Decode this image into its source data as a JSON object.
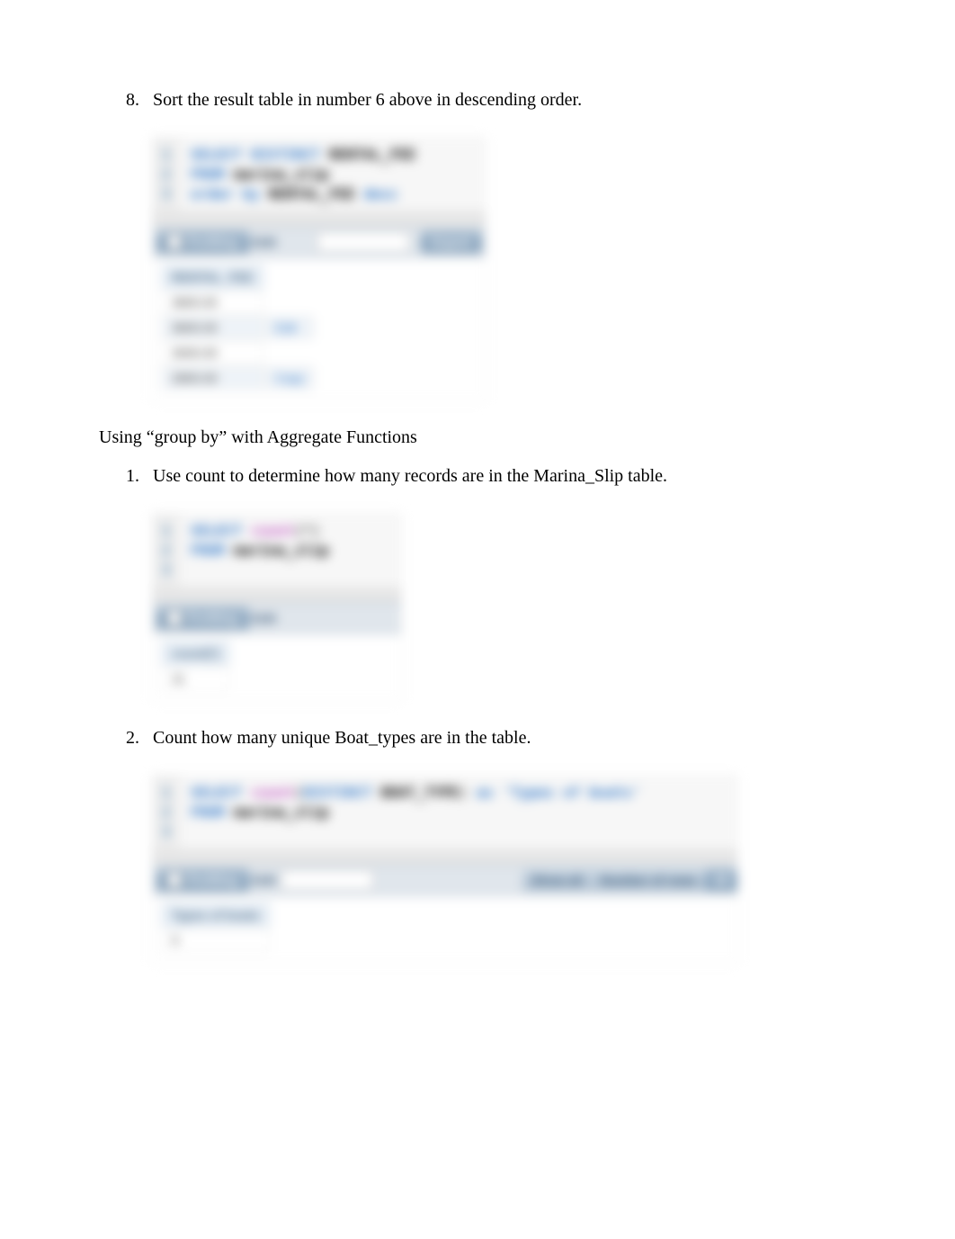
{
  "q8": {
    "num": "8.",
    "text": "Sort the result table in number 6 above in descending order."
  },
  "shot1": {
    "gutter": [
      "1",
      "2",
      "3"
    ],
    "code_html": "<span class='kw'>SELECT</span> <span class='kw'>DISTINCT</span> <span class='id'>RENTAL_FEE</span>\n<span class='kw'>FROM</span> <span class='id'>marina_slip</span>\n<span class='kw'>order by</span> <span class='id'>RENTAL_FEE</span> <span class='kw'>desc</span>",
    "toolbar": {
      "profiling": "Profiling",
      "edit": "Edit",
      "inline": "Inline",
      "extra": "Export"
    },
    "result": {
      "header": [
        "RENTAL_FEE"
      ],
      "rows": [
        [
          "3800.00"
        ],
        [
          "3600.00"
        ],
        [
          "3000.00"
        ],
        [
          "2800.00"
        ]
      ],
      "links": [
        "Edit",
        "Copy"
      ]
    }
  },
  "heading": "Using “group by” with Aggregate Functions",
  "q1": {
    "num": "1.",
    "text": "Use count to determine how many records are in the Marina_Slip table."
  },
  "shot2": {
    "gutter": [
      "1",
      "2",
      "3"
    ],
    "code_html": "<span class='kw'>SELECT</span> <span class='fn'>count</span>(*)\n<span class='kw'>FROM</span> <span class='id'>marina_slip</span>",
    "toolbar": {
      "profiling": "Profiling",
      "edit": "Edit",
      "inline": "Inline"
    },
    "result": {
      "header": [
        "count(*)"
      ],
      "rows": [
        [
          "11"
        ]
      ]
    }
  },
  "q2": {
    "num": "2.",
    "text": "Count how many unique Boat_types are in the table."
  },
  "shot3": {
    "gutter": [
      "1",
      "2",
      "3"
    ],
    "code_html": "<span class='kw'>SELECT</span> <span class='fn'>count</span>(<span class='kw'>DISTINCT</span> <span class='id'>BOAT_TYPE</span>) <span class='kw'>as</span> <span class='str'>'Types of boats'</span>\n<span class='kw'>FROM</span> <span class='id'>marina_slip</span>",
    "toolbar": {
      "profiling": "Profiling",
      "edit": "Edit",
      "inline": "Inline",
      "right1": "Show all",
      "right2": "Number of rows",
      "right3": "25"
    },
    "result": {
      "header": [
        "Types of boats"
      ],
      "rows": [
        [
          "5"
        ]
      ]
    }
  }
}
